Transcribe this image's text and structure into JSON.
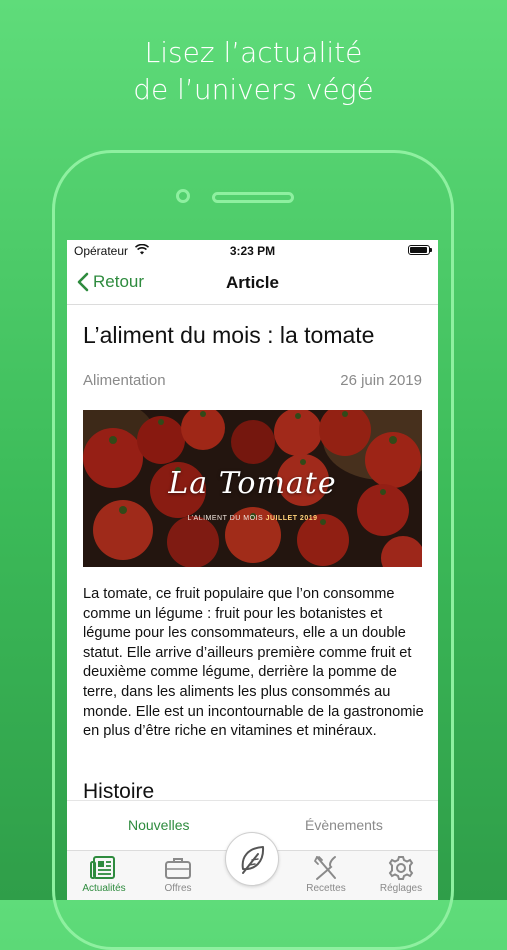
{
  "promo": {
    "line1": "Lisez l’actualité",
    "line2": "de l’univers végé"
  },
  "status_bar": {
    "carrier": "Opérateur",
    "time": "3:23 PM"
  },
  "nav": {
    "back_label": "Retour",
    "title": "Article"
  },
  "article": {
    "title": "L’aliment du mois : la tomate",
    "category": "Alimentation",
    "date": "26 juin 2019",
    "image_title": "La Tomate",
    "image_subtitle_prefix": "L’ALIMENT DU MOIS ",
    "image_subtitle_highlight": "JUILLET 2019",
    "body": "La tomate, ce fruit populaire que l’on consomme comme un légume : fruit pour les botanistes et légume pour les consommateurs, elle a un double statut. Elle arrive d’ailleurs première comme fruit et deuxième comme légume, derrière la pomme de terre, dans les aliments les plus consommés au monde. Elle est un incontournable de la gastronomie en plus d’être riche en vitamines et minéraux.",
    "section_heading": "Histoire"
  },
  "segments": {
    "left": "Nouvelles",
    "right": "Évènements",
    "active": "left"
  },
  "tabbar": {
    "items": [
      {
        "label": "Actualités",
        "icon": "newspaper-icon",
        "active": true
      },
      {
        "label": "Offres",
        "icon": "briefcase-icon",
        "active": false
      },
      {
        "label": "",
        "icon": "leaf-icon",
        "active": false
      },
      {
        "label": "Recettes",
        "icon": "fork-knife-icon",
        "active": false
      },
      {
        "label": "Réglages",
        "icon": "gear-icon",
        "active": false
      }
    ]
  },
  "colors": {
    "background_green": "#4cc766",
    "accent_green": "#2e8b3e",
    "phone_outline": "#8ef0a0"
  }
}
